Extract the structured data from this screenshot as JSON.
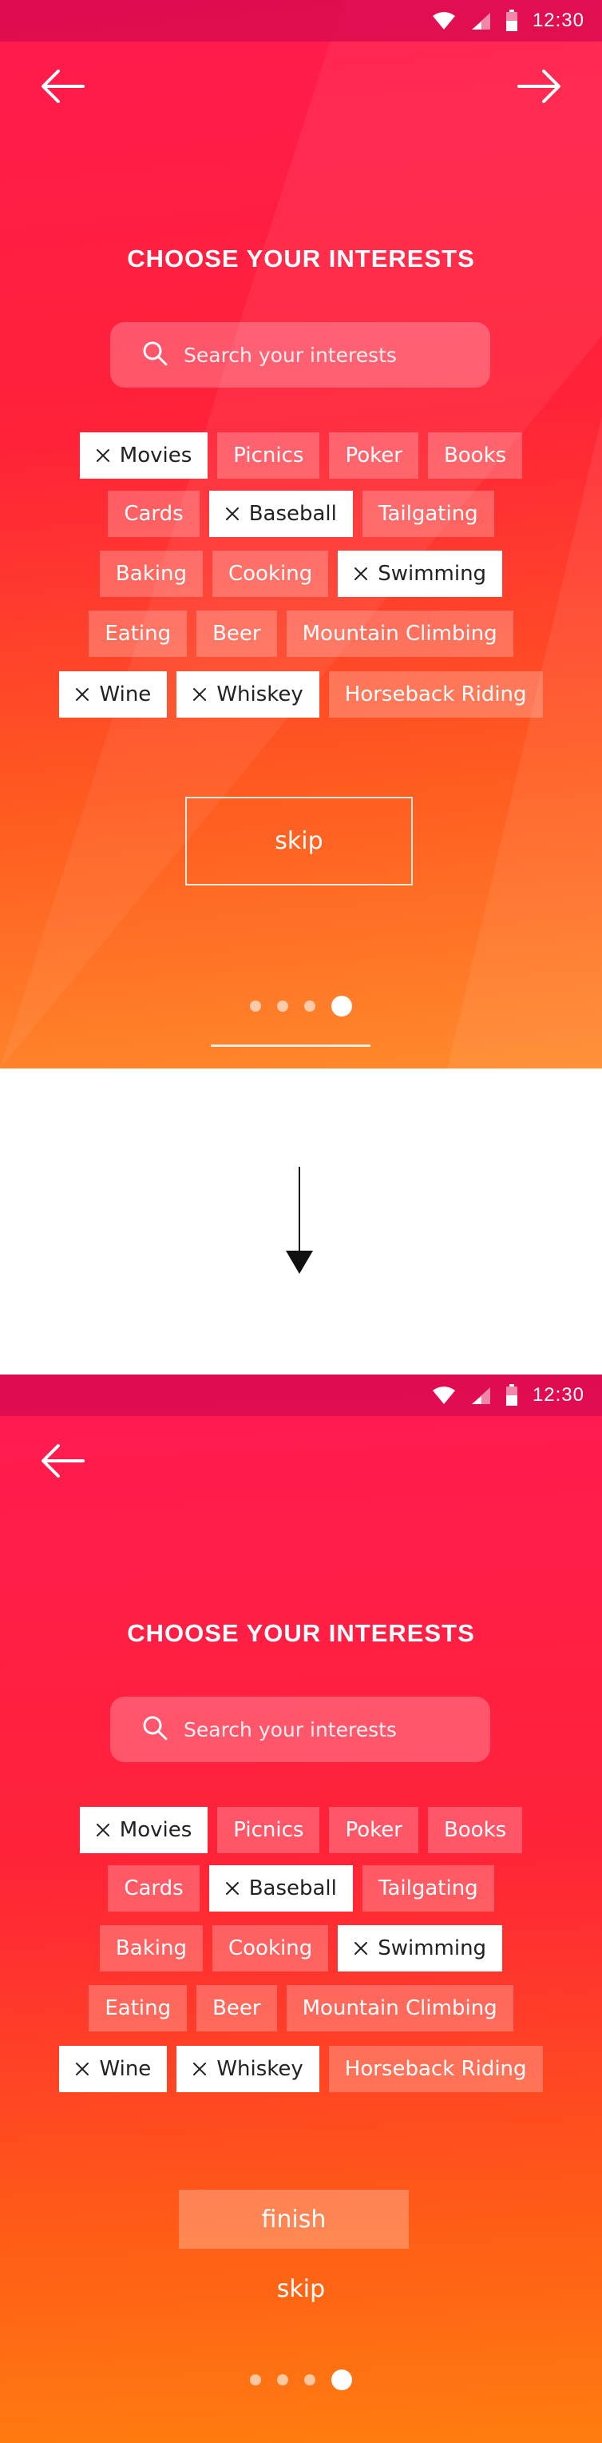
{
  "status_bar": {
    "time": "12:30"
  },
  "title": "CHOOSE YOUR INTERESTS",
  "search": {
    "placeholder": "Search your interests"
  },
  "interests": {
    "rows": [
      [
        {
          "label": "Movies",
          "selected": true
        },
        {
          "label": "Picnics",
          "selected": false
        },
        {
          "label": "Poker",
          "selected": false
        },
        {
          "label": "Books",
          "selected": false
        }
      ],
      [
        {
          "label": "Cards",
          "selected": false
        },
        {
          "label": "Baseball",
          "selected": true
        },
        {
          "label": "Tailgating",
          "selected": false
        }
      ],
      [
        {
          "label": "Baking",
          "selected": false
        },
        {
          "label": "Cooking",
          "selected": false
        },
        {
          "label": "Swimming",
          "selected": true
        }
      ],
      [
        {
          "label": "Eating",
          "selected": false
        },
        {
          "label": "Beer",
          "selected": false
        },
        {
          "label": "Mountain Climbing",
          "selected": false
        }
      ],
      [
        {
          "label": "Wine",
          "selected": true
        },
        {
          "label": "Whiskey",
          "selected": true
        },
        {
          "label": "Horseback Riding",
          "selected": false
        }
      ]
    ]
  },
  "screen1": {
    "skip_label": "skip",
    "page_count": 4,
    "current_page": 4
  },
  "screen2": {
    "finish_label": "finish",
    "skip_label": "skip",
    "page_count": 4,
    "current_page": 4
  },
  "icons": {
    "back": "arrow-left-icon",
    "forward": "arrow-right-icon",
    "search": "search-icon",
    "remove": "close-icon",
    "wifi": "wifi-icon",
    "signal": "signal-icon",
    "battery": "battery-icon",
    "flow": "arrow-down-icon"
  },
  "colors": {
    "gradient_top": "#ff1a4f",
    "gradient_bottom": "#ff7d10",
    "chip_selected": "#ffffff"
  }
}
